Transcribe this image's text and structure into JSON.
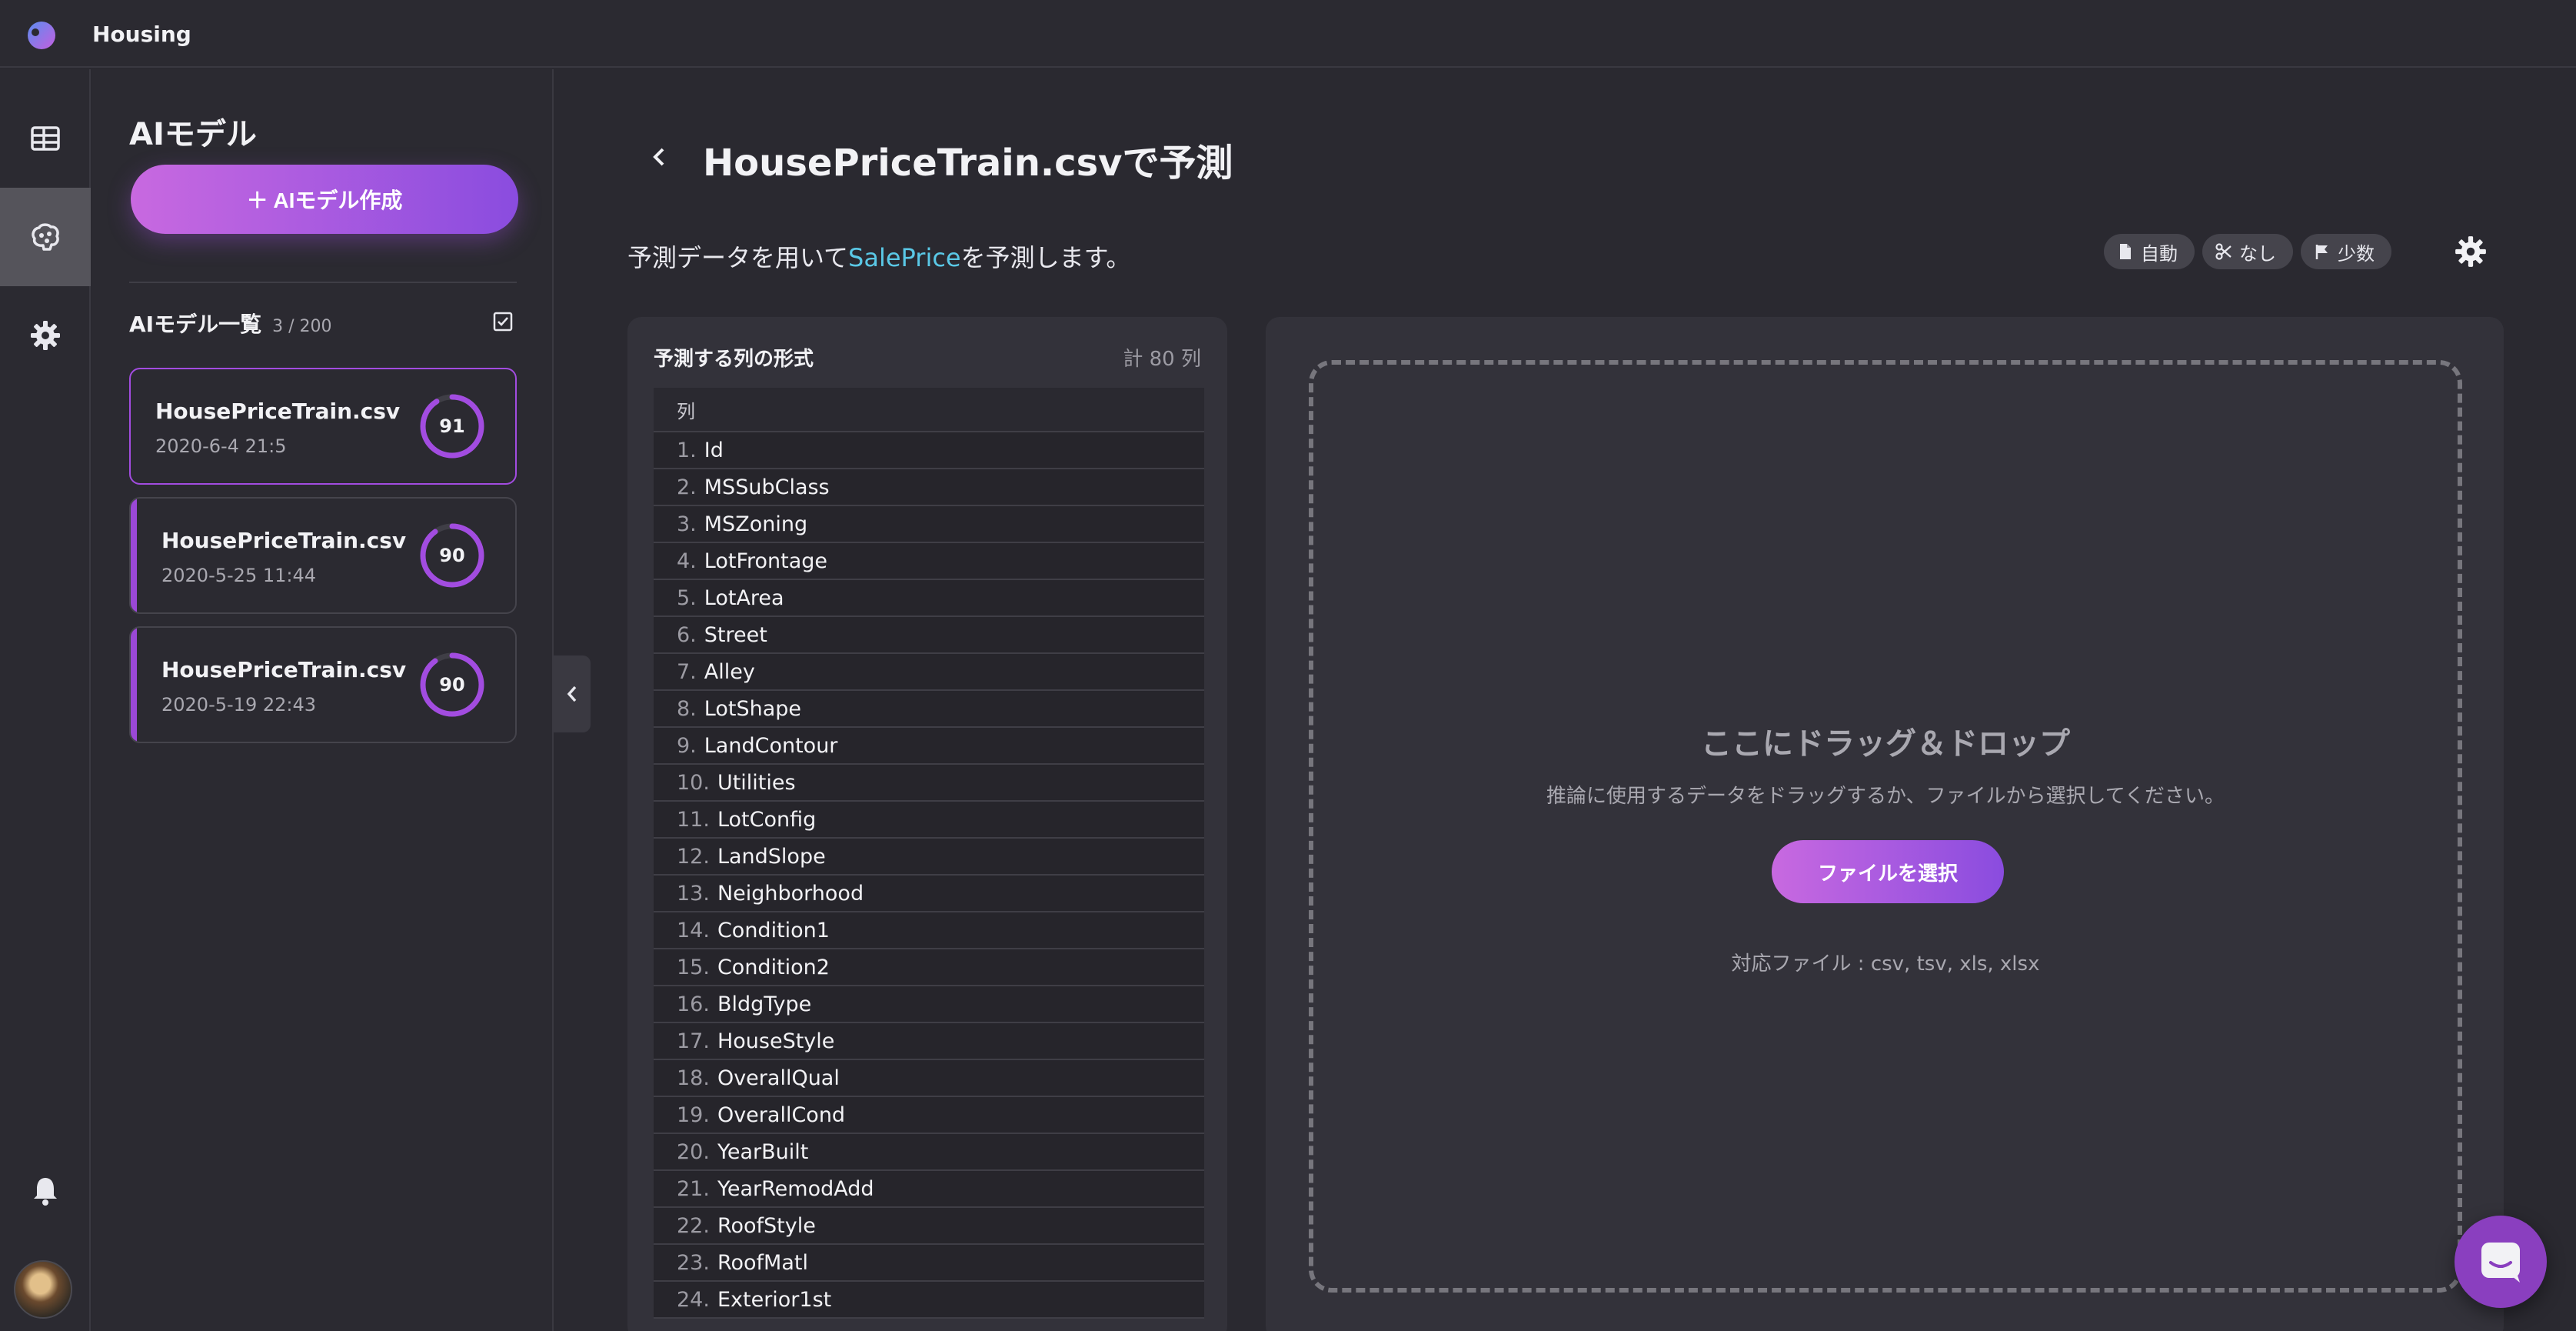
{
  "app": {
    "title": "Housing"
  },
  "rail": {
    "items": [
      "table-icon",
      "brain-icon",
      "gear-icon"
    ],
    "active": 1
  },
  "panel": {
    "title": "AIモデル",
    "create_label": "＋ AIモデル作成",
    "list_title": "AIモデル一覧",
    "list_count": "3 / 200",
    "models": [
      {
        "name": "HousePriceTrain.csv",
        "date": "2020-6-4 21:5",
        "score": "91",
        "score_value": 91,
        "selected": true
      },
      {
        "name": "HousePriceTrain.csv",
        "date": "2020-5-25 11:44",
        "score": "90",
        "score_value": 90,
        "selected": false
      },
      {
        "name": "HousePriceTrain.csv",
        "date": "2020-5-19 22:43",
        "score": "90",
        "score_value": 90,
        "selected": false
      }
    ]
  },
  "main": {
    "title": "HousePriceTrain.csvで予測",
    "desc_pre": "予測データを用いて",
    "desc_target": "SalePrice",
    "desc_post": "を予測します。",
    "chips": [
      {
        "icon": "file-icon",
        "label": "自動"
      },
      {
        "icon": "scissors-icon",
        "label": "なし"
      },
      {
        "icon": "flag-icon",
        "label": "少数"
      }
    ]
  },
  "columns": {
    "title": "予測する列の形式",
    "total": "計 80 列",
    "header": "列",
    "rows": [
      {
        "num": "1.",
        "name": "Id"
      },
      {
        "num": "2.",
        "name": "MSSubClass"
      },
      {
        "num": "3.",
        "name": "MSZoning"
      },
      {
        "num": "4.",
        "name": "LotFrontage"
      },
      {
        "num": "5.",
        "name": "LotArea"
      },
      {
        "num": "6.",
        "name": "Street"
      },
      {
        "num": "7.",
        "name": "Alley"
      },
      {
        "num": "8.",
        "name": "LotShape"
      },
      {
        "num": "9.",
        "name": "LandContour"
      },
      {
        "num": "10.",
        "name": "Utilities"
      },
      {
        "num": "11.",
        "name": "LotConfig"
      },
      {
        "num": "12.",
        "name": "LandSlope"
      },
      {
        "num": "13.",
        "name": "Neighborhood"
      },
      {
        "num": "14.",
        "name": "Condition1"
      },
      {
        "num": "15.",
        "name": "Condition2"
      },
      {
        "num": "16.",
        "name": "BldgType"
      },
      {
        "num": "17.",
        "name": "HouseStyle"
      },
      {
        "num": "18.",
        "name": "OverallQual"
      },
      {
        "num": "19.",
        "name": "OverallCond"
      },
      {
        "num": "20.",
        "name": "YearBuilt"
      },
      {
        "num": "21.",
        "name": "YearRemodAdd"
      },
      {
        "num": "22.",
        "name": "RoofStyle"
      },
      {
        "num": "23.",
        "name": "RoofMatl"
      },
      {
        "num": "24.",
        "name": "Exterior1st"
      }
    ]
  },
  "drop": {
    "title": "ここにドラッグ＆ドロップ",
    "sub": "推論に使用するデータをドラッグするか、ファイルから選択してください。",
    "button": "ファイルを選択",
    "formats": "対応ファイル : csv, tsv, xls, xlsx"
  },
  "colors": {
    "accent": "#9a48d6",
    "gradient_start": "#c869e0",
    "gradient_end": "#8a4cdf",
    "highlight": "#5ac8e6"
  }
}
